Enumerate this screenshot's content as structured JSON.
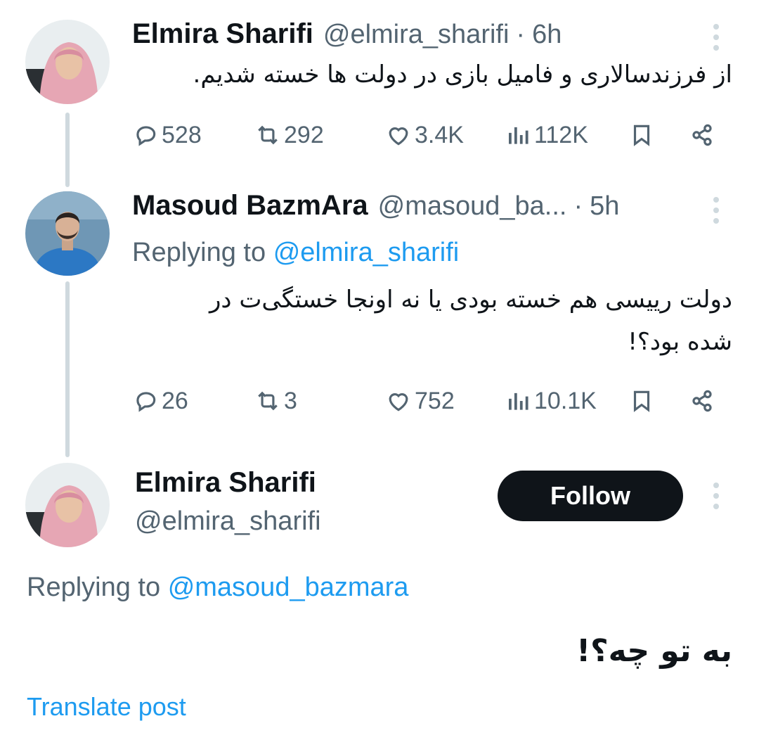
{
  "thread": [
    {
      "name": "Elmira Sharifi",
      "handle": "@elmira_sharifi",
      "separator": "·",
      "time": "6h",
      "text": "از فرزندسالاری و فامیل بازی در دولت ها خسته شدیم.",
      "stats": {
        "replies": "528",
        "reposts": "292",
        "likes": "3.4K",
        "views": "112K"
      }
    },
    {
      "name": "Masoud BazmAra",
      "handle": "@masoud_ba...",
      "separator": "·",
      "time": "5h",
      "replying_prefix": "Replying to",
      "replying_to": "@elmira_sharifi",
      "text_line1": "دولت رییسی هم خسته بودی یا نه اونجا خستگی‌ت در",
      "text_line2": "شده بود؟!",
      "stats": {
        "replies": "26",
        "reposts": "3",
        "likes": "752",
        "views": "10.1K"
      }
    }
  ],
  "main_post": {
    "name": "Elmira Sharifi",
    "handle": "@elmira_sharifi",
    "follow_label": "Follow",
    "replying_prefix": "Replying to",
    "replying_to": "@masoud_bazmara",
    "text": "به تو چه؟!",
    "translate_label": "Translate post"
  },
  "icons": {
    "reply": "reply-icon",
    "repost": "repost-icon",
    "like": "heart-icon",
    "views": "views-icon",
    "bookmark": "bookmark-icon",
    "share": "share-icon",
    "more": "more-icon"
  },
  "colors": {
    "text": "#0f1419",
    "secondary": "#536471",
    "accent": "#1d9bf0",
    "line": "#cfd9de",
    "follow_bg": "#0f1419"
  }
}
